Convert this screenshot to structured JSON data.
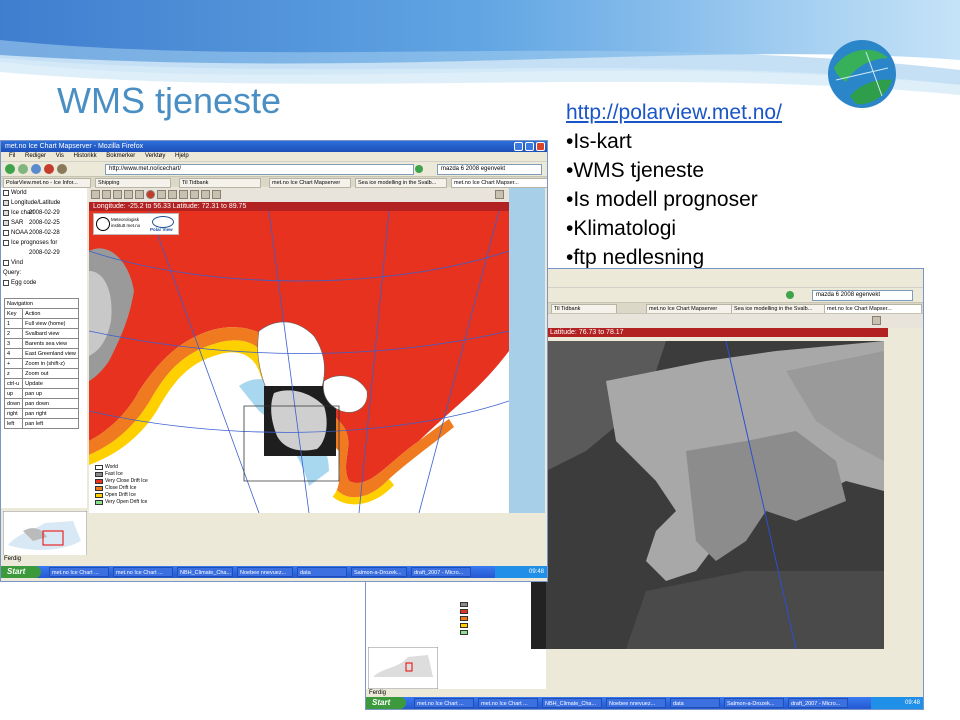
{
  "slide": {
    "title": "WMS tjeneste",
    "link": "http://polarview.met.no/",
    "bullets": [
      "•Is-kart",
      "•WMS tjeneste",
      "•Is modell prognoser",
      "•Klimatologi",
      "•ftp nedlesning"
    ]
  },
  "colors": {
    "title": "#4a8fc4",
    "link": "#1a55c8",
    "sea_ice": "#e6321e",
    "land": "#ffffff",
    "ocean_grid": "#3a5fd0"
  },
  "front_window": {
    "title": "met.no Ice Chart Mapserver - Mozilla Firefox",
    "menu": [
      "Fil",
      "Rediger",
      "Vis",
      "Historikk",
      "Bokmerker",
      "Verktøy",
      "Hjelp"
    ],
    "url": "http://www.met.no/icechart/",
    "search_value": "mazda 6 2008 egenvekt",
    "tabs": [
      "PolarView.met.no - Ice Infor...",
      "Shipping",
      "Til Tidbank",
      "met.no Ice Chart Mapserver",
      "Sea ice modelling in the Svalb...",
      "met.no Ice Chart Mapser..."
    ],
    "coord_text": "Longitude: -25.2 to 56.33      Latitude: 72.31 to 89.75",
    "logo_text": "Meteorologisk institutt met.no",
    "polar_view_label": "Polar View",
    "layers": [
      {
        "label": "World",
        "date": ""
      },
      {
        "label": "Longitude/Latitude",
        "date": ""
      },
      {
        "label": "Ice chart",
        "date": "2008-02-29"
      },
      {
        "label": "SAR",
        "date": "2008-02-25"
      },
      {
        "label": "NOAA",
        "date": "2008-02-28"
      },
      {
        "label": "Ice prognoses for",
        "date": ""
      },
      {
        "label": "",
        "date": "2008-02-29"
      },
      {
        "label": "Vind",
        "date": ""
      },
      {
        "label": "Query:",
        "date": ""
      },
      {
        "label": "Egg code",
        "date": ""
      }
    ],
    "navigation": {
      "title": "Navigation",
      "headers": [
        "Key",
        "Action"
      ],
      "rows": [
        [
          "1",
          "Full view (home)"
        ],
        [
          "2",
          "Svalbard view"
        ],
        [
          "3",
          "Barents sea view"
        ],
        [
          "4",
          "East Greenland view"
        ],
        [
          "+",
          "Zoom in (shift-z)"
        ],
        [
          "z",
          "Zoom out"
        ],
        [
          "ctrl-u",
          "Update"
        ],
        [
          "up",
          "pan up"
        ],
        [
          "down",
          "pan down"
        ],
        [
          "right",
          "pan right"
        ],
        [
          "left",
          "pan left"
        ]
      ]
    },
    "legend": [
      "World",
      "Fast Ice",
      "Very Close Drift Ice",
      "Close Drift Ice",
      "Open Drift Ice",
      "Very Open Drift Ice"
    ],
    "legend_colors": [
      "#ffffff",
      "#8a8a8a",
      "#e6321e",
      "#f07a20",
      "#ffd000",
      "#8ee08e"
    ],
    "status": "Ferdig"
  },
  "back_window": {
    "search_value": "mazda 6 2008 egenvekt",
    "tabs": [
      "Til Tidbank",
      "met.no Ice Chart Mapserver",
      "Sea ice modelling in the Svalb...",
      "met.no Ice Chart Mapser..."
    ],
    "coord_text": "Latitude: 76.73 to 78.17",
    "status": "Ferdig"
  },
  "taskbar": {
    "start_label": "Start",
    "items": [
      "met.no Ice Chart ...",
      "met.no Ice Chart ...",
      "NBH_Climate_Cha...",
      "Noebee nnevuez...",
      "data",
      "Salmon-a-Drozek...",
      "draft_2007 - Micro..."
    ],
    "clock": "09:48"
  },
  "back_taskbar": {
    "start_label": "Start",
    "items": [
      "met.no Ice Chart ...",
      "met.no Ice Chart ...",
      "NBH_Climate_Cha...",
      "Noebee nnevuez...",
      "data",
      "Salmon-a-Drozek...",
      "draft_2007 - Micro..."
    ],
    "clock": "09:48"
  }
}
